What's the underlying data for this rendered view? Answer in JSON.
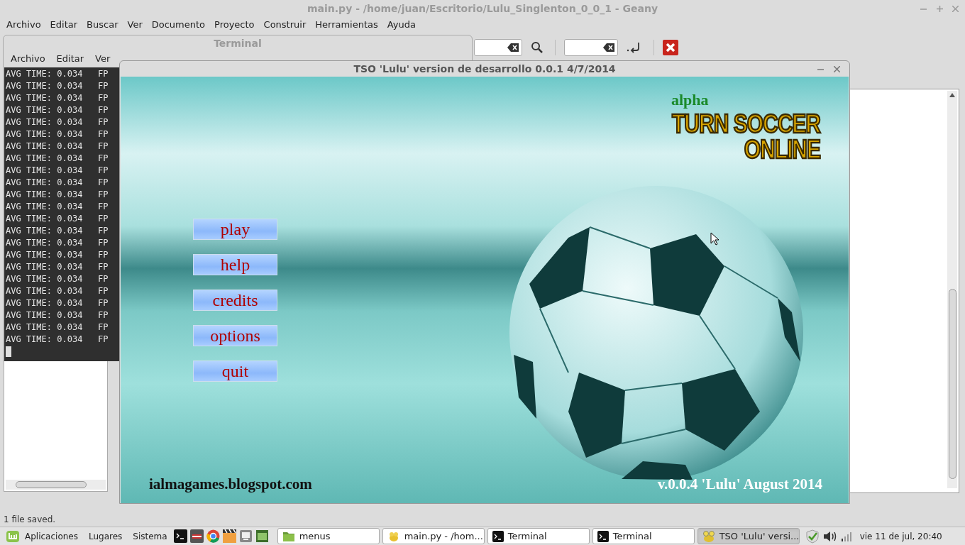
{
  "editor_window": {
    "title": "main.py - /home/juan/Escritorio/Lulu_Singlenton_0_0_1 - Geany",
    "menu": [
      "Archivo",
      "Editar",
      "Buscar",
      "Ver",
      "Documento",
      "Proyecto",
      "Construir",
      "Herramientas",
      "Ayuda"
    ],
    "status": "1 file saved."
  },
  "terminal_window": {
    "title": "Terminal",
    "menu": [
      "Archivo",
      "Editar",
      "Ver"
    ],
    "lines": [
      "AVG TIME: 0.034   FP",
      "AVG TIME: 0.034   FP",
      "AVG TIME: 0.034   FP",
      "AVG TIME: 0.034   FP",
      "AVG TIME: 0.034   FP",
      "AVG TIME: 0.034   FP",
      "AVG TIME: 0.034   FP",
      "AVG TIME: 0.034   FP",
      "AVG TIME: 0.034   FP",
      "AVG TIME: 0.034   FP",
      "AVG TIME: 0.034   FP",
      "AVG TIME: 0.034   FP",
      "AVG TIME: 0.034   FP",
      "AVG TIME: 0.034   FP",
      "AVG TIME: 0.034   FP",
      "AVG TIME: 0.034   FP",
      "AVG TIME: 0.034   FP",
      "AVG TIME: 0.034   FP",
      "AVG TIME: 0.034   FP",
      "AVG TIME: 0.034   FP",
      "AVG TIME: 0.034   FP",
      "AVG TIME: 0.034   FP",
      "AVG TIME: 0.034   FP"
    ]
  },
  "game_window": {
    "title": "TSO 'Lulu' version de desarrollo 0.0.1 4/7/2014",
    "menu_buttons": [
      "play",
      "help",
      "credits",
      "options",
      "quit"
    ],
    "tag": "alpha",
    "logo_lines": [
      "TURN SOCCER",
      "ONLINE"
    ],
    "website": "ialmagames.blogspot.com",
    "version": "v.0.0.4 'Lulu' August 2014"
  },
  "taskbar": {
    "menus": [
      "Aplicaciones",
      "Lugares",
      "Sistema"
    ],
    "windows": [
      {
        "label": "menus",
        "kind": "folder",
        "selected": false
      },
      {
        "label": "main.py - /hom...",
        "kind": "editor",
        "selected": false
      },
      {
        "label": "Terminal",
        "kind": "terminal",
        "selected": false
      },
      {
        "label": "Terminal",
        "kind": "terminal",
        "selected": false
      },
      {
        "label": "TSO 'Lulu' versi...",
        "kind": "game",
        "selected": true
      }
    ],
    "clock": "vie 11 de jul, 20:40"
  }
}
